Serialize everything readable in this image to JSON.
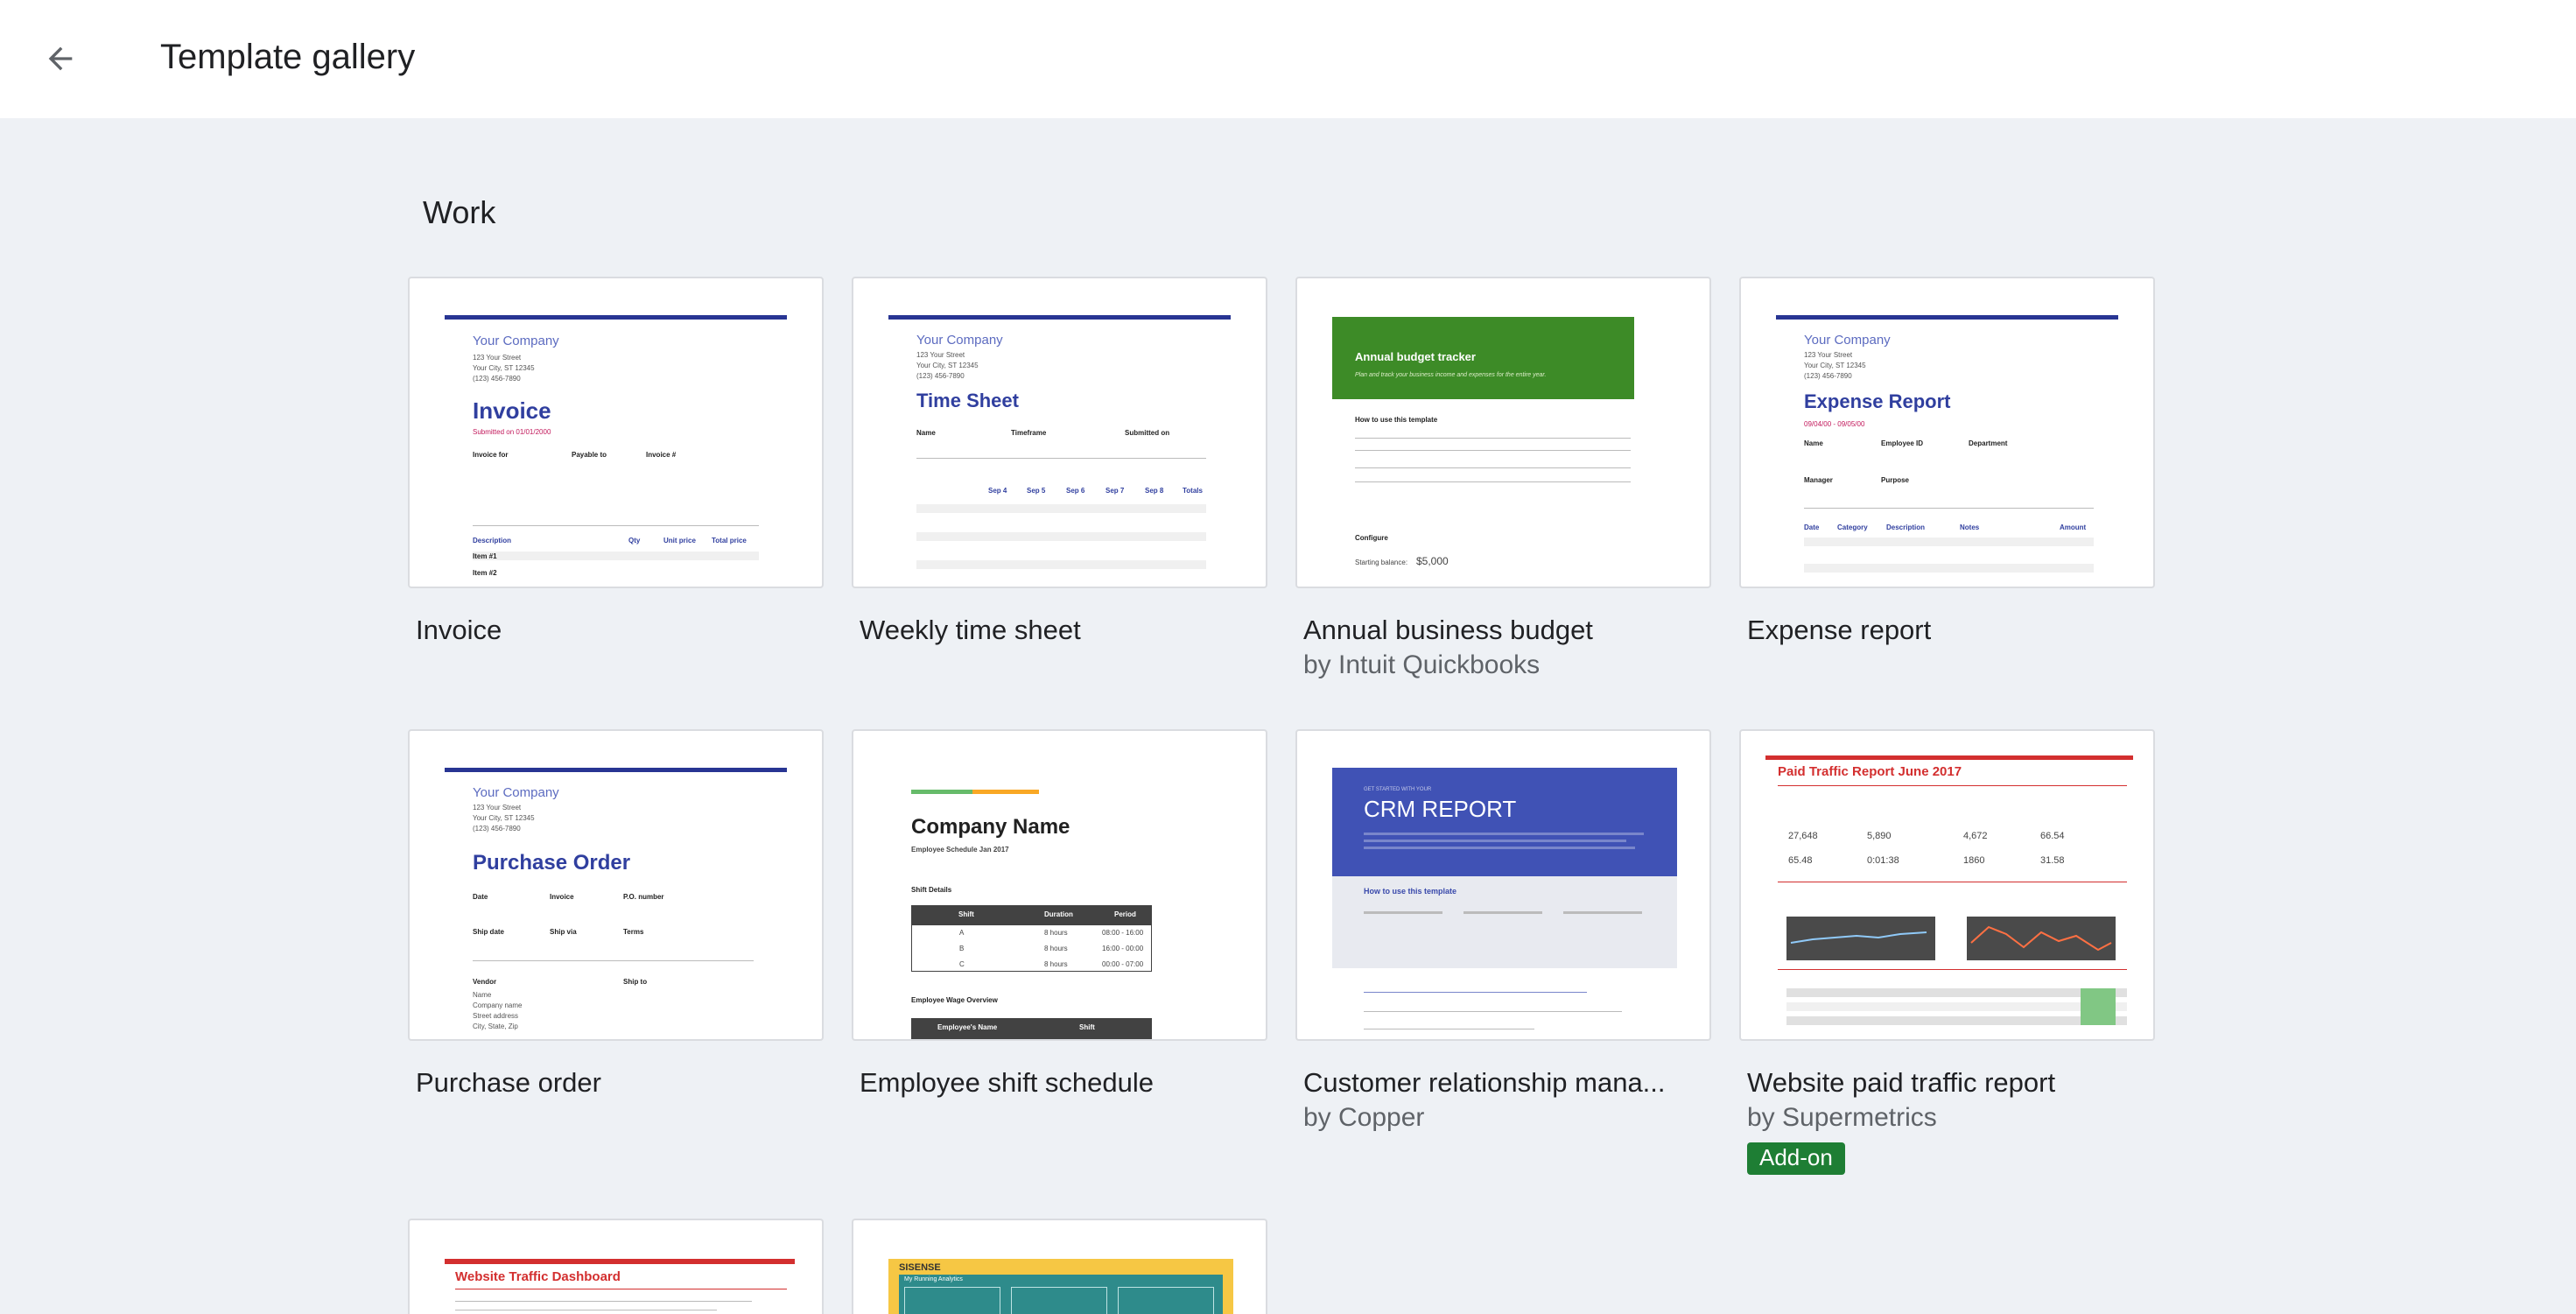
{
  "header": {
    "title": "Template gallery",
    "back_icon": "arrow-back-icon"
  },
  "section": {
    "title": "Work"
  },
  "colors": {
    "accent_green": "#1e7e34",
    "brand_blue": "#283593",
    "budget_green": "#3d8b27",
    "crm_blue": "#4052b5",
    "traffic_red": "#d32f2f"
  },
  "templates": [
    {
      "title": "Invoice",
      "subtitle": ""
    },
    {
      "title": "Weekly time sheet",
      "subtitle": ""
    },
    {
      "title": "Annual business budget",
      "subtitle": "by Intuit Quickbooks"
    },
    {
      "title": "Expense report",
      "subtitle": ""
    },
    {
      "title": "Purchase order",
      "subtitle": ""
    },
    {
      "title": "Employee shift schedule",
      "subtitle": ""
    },
    {
      "title": "Customer relationship mana...",
      "subtitle": "by Copper"
    },
    {
      "title": "Website paid traffic report",
      "subtitle": "by Supermetrics",
      "badge": "Add-on"
    }
  ],
  "thumbs": {
    "invoice": {
      "company": "Your Company",
      "addr1": "123 Your Street",
      "addr2": "Your City, ST 12345",
      "addr3": "(123) 456-7890",
      "title": "Invoice",
      "submitted": "Submitted on 01/01/2000",
      "invoice_for": "Invoice for",
      "payable_to": "Payable to",
      "invoice_no": "Invoice #",
      "desc": "Description",
      "qty": "Qty",
      "unit": "Unit price",
      "total": "Total price",
      "item1": "Item #1",
      "item2": "Item #2"
    },
    "timesheet": {
      "company": "Your Company",
      "addr1": "123 Your Street",
      "addr2": "Your City, ST 12345",
      "addr3": "(123) 456-7890",
      "title": "Time Sheet",
      "name": "Name",
      "timeframe": "Timeframe",
      "submitted": "Submitted on",
      "days": [
        "Sep 4",
        "Sep 5",
        "Sep 6",
        "Sep 7",
        "Sep 8",
        "Totals"
      ]
    },
    "budget": {
      "title": "Annual budget tracker",
      "tagline": "Plan and track your business income and expenses for the entire year.",
      "howto": "How to use this template",
      "configure": "Configure",
      "starting": "Starting balance:",
      "amount": "$5,000"
    },
    "expense": {
      "company": "Your Company",
      "addr1": "123 Your Street",
      "addr2": "Your City, ST 12345",
      "addr3": "(123) 456-7890",
      "title": "Expense Report",
      "dates": "09/04/00 - 09/05/00",
      "name": "Name",
      "employee_id": "Employee ID",
      "department": "Department",
      "manager": "Manager",
      "purpose": "Purpose",
      "date": "Date",
      "category": "Category",
      "description": "Description",
      "notes": "Notes",
      "amount": "Amount"
    },
    "po": {
      "company": "Your Company",
      "addr1": "123 Your Street",
      "addr2": "Your City, ST 12345",
      "addr3": "(123) 456-7890",
      "title": "Purchase Order",
      "date": "Date",
      "invoice": "Invoice",
      "po_number": "P.O. number",
      "ship_date": "Ship date",
      "ship_via": "Ship via",
      "terms": "Terms",
      "vendor": "Vendor",
      "ship_to": "Ship to"
    },
    "shift": {
      "company": "Company Name",
      "subtitle": "Employee Schedule Jan 2017",
      "details": "Shift Details",
      "cols": [
        "Shift",
        "Duration",
        "Period"
      ],
      "rows": [
        [
          "A",
          "8 hours",
          "08:00 - 16:00"
        ],
        [
          "B",
          "8 hours",
          "16:00 - 00:00"
        ],
        [
          "C",
          "8 hours",
          "00:00 - 07:00"
        ]
      ],
      "wage": "Employee Wage Overview",
      "wcols": [
        "Employee's Name",
        "Shift"
      ]
    },
    "crm": {
      "kicker": "GET STARTED WITH YOUR",
      "title": "CRM REPORT",
      "howto": "How to use this template"
    },
    "traffic": {
      "title": "Paid Traffic Report June 2017",
      "nums": [
        "27,648",
        "5,890",
        "4,672",
        "66.54",
        "65.48",
        "0:01:38",
        "1860",
        "31.58"
      ]
    },
    "dashboard": {
      "title": "Website Traffic Dashboard"
    },
    "sisense": {
      "brand": "SISENSE",
      "label": "My Running Analytics"
    }
  }
}
